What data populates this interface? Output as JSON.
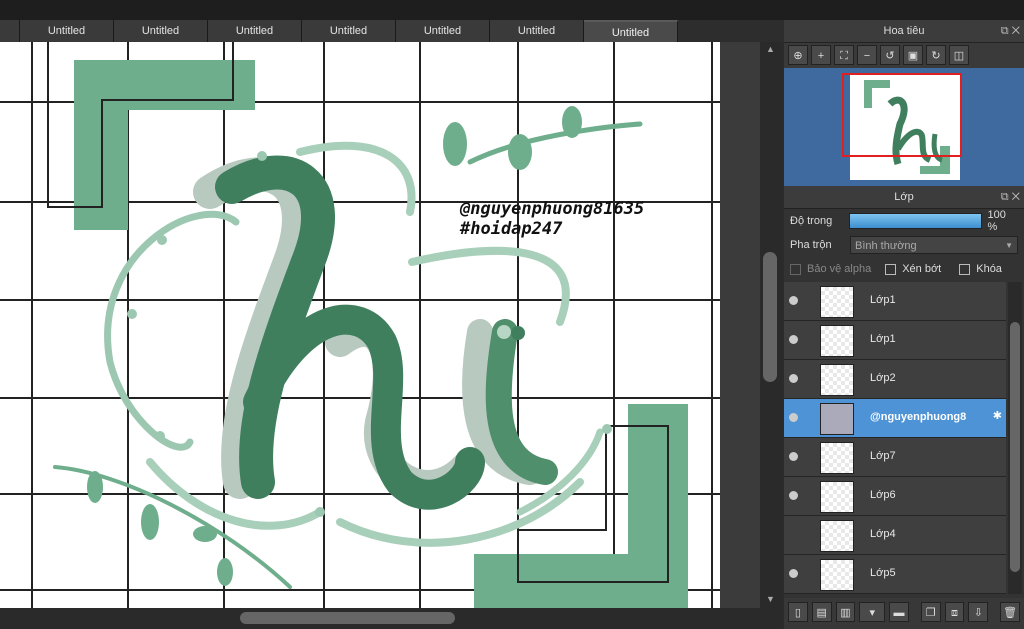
{
  "tabs": [
    "Untitled",
    "Untitled",
    "Untitled",
    "Untitled",
    "Untitled",
    "Untitled",
    "Untitled"
  ],
  "canvas": {
    "text_line1": "@nguyenphuong81635",
    "text_line2": "#hoidap247",
    "lettering": "hi"
  },
  "navigator": {
    "title": "Hoa tiêu"
  },
  "layers_panel": {
    "title": "Lớp",
    "opacity_label": "Độ trong",
    "opacity_value": "100 %",
    "blend_label": "Pha trộn",
    "blend_value": "Bình thường",
    "protect_alpha": "Bảo vệ alpha",
    "clipping": "Xén bớt",
    "lock": "Khóa",
    "layers": [
      {
        "name": "Lớp1"
      },
      {
        "name": "Lớp1"
      },
      {
        "name": "Lớp2"
      },
      {
        "name": "@nguyenphuong8"
      },
      {
        "name": "Lớp7"
      },
      {
        "name": "Lớp6"
      },
      {
        "name": "Lớp4"
      },
      {
        "name": "Lớp5"
      }
    ]
  },
  "colors": {
    "accent_green": "#6fae8c",
    "dark_green": "#3f7f5e",
    "selection_blue": "#4e93d6"
  }
}
